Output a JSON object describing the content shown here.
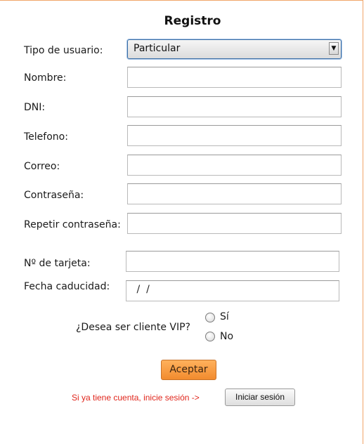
{
  "form": {
    "title": "Registro",
    "user_type": {
      "label": "Tipo de usuario:",
      "selected": "Particular"
    },
    "fields": {
      "name": {
        "label": "Nombre:",
        "value": ""
      },
      "dni": {
        "label": "DNI:",
        "value": ""
      },
      "phone": {
        "label": "Telefono:",
        "value": ""
      },
      "email": {
        "label": "Correo:",
        "value": ""
      },
      "password": {
        "label": "Contraseña:",
        "value": ""
      },
      "repeat_password": {
        "label": "Repetir contraseña:",
        "value": ""
      },
      "card_number": {
        "label": "Nº de tarjeta:",
        "value": ""
      },
      "expiry": {
        "label": "Fecha caducidad:",
        "value": " /  /"
      }
    },
    "vip": {
      "question": "¿Desea ser cliente VIP?",
      "yes_label": "Sí",
      "no_label": "No"
    },
    "accept_label": "Aceptar",
    "login_hint": "Si ya tiene cuenta, inicie sesión ->",
    "login_label": "Iniciar sesión"
  },
  "colors": {
    "accent_orange": "#f28b2e",
    "hint_red": "#e0251b",
    "select_border": "#3a6ea5"
  }
}
